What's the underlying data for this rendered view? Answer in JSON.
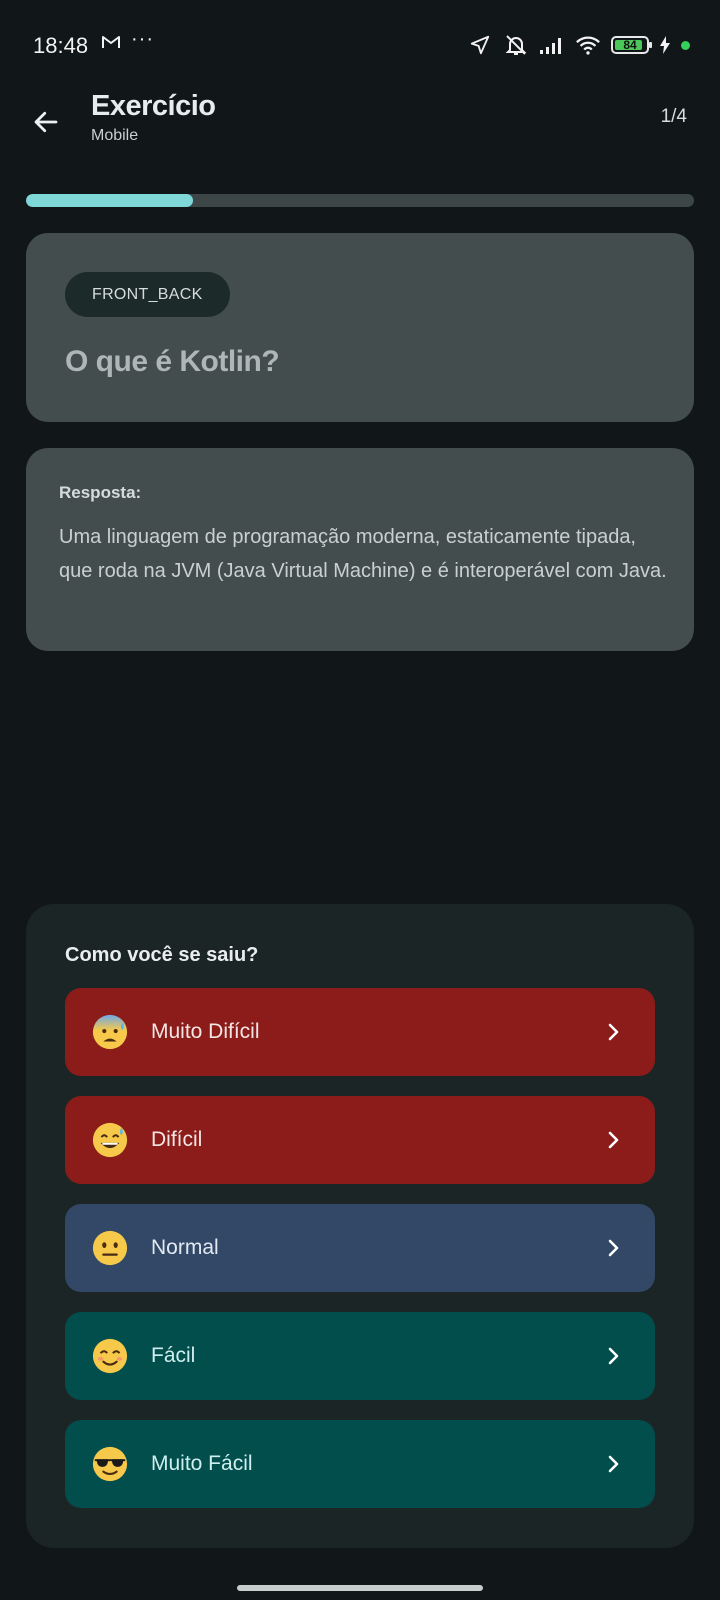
{
  "status_bar": {
    "time": "18:48",
    "mail_icon": "gmail-icon",
    "more": "···",
    "battery_level": "84",
    "icons": [
      "location-arrow-icon",
      "bell-muted-icon",
      "signal-icon",
      "wifi-icon",
      "battery-icon",
      "charging-icon"
    ]
  },
  "header": {
    "back_icon": "arrow-left-icon",
    "title": "Exercício",
    "subtitle": "Mobile",
    "counter": "1/4"
  },
  "progress": {
    "fraction": 0.25,
    "color": "#7fd8d8"
  },
  "question_card": {
    "tag": "FRONT_BACK",
    "question": "O que é Kotlin?"
  },
  "answer_card": {
    "label": "Resposta:",
    "text": "Uma linguagem de programação moderna, estaticamente tipada, que roda na JVM (Java Virtual Machine) e é interoperável com Java."
  },
  "rating": {
    "title": "Como você se saiu?",
    "options": [
      {
        "label": "Muito Difícil",
        "emoji": "anxious-sweat-face-emoji",
        "color": "#8c1c1a"
      },
      {
        "label": "Difícil",
        "emoji": "grinning-sweat-face-emoji",
        "color": "#8c1c1a"
      },
      {
        "label": "Normal",
        "emoji": "neutral-face-emoji",
        "color": "#334866"
      },
      {
        "label": "Fácil",
        "emoji": "smiling-face-emoji",
        "color": "#024e4d"
      },
      {
        "label": "Muito Fácil",
        "emoji": "sunglasses-face-emoji",
        "color": "#024e4d"
      }
    ]
  }
}
